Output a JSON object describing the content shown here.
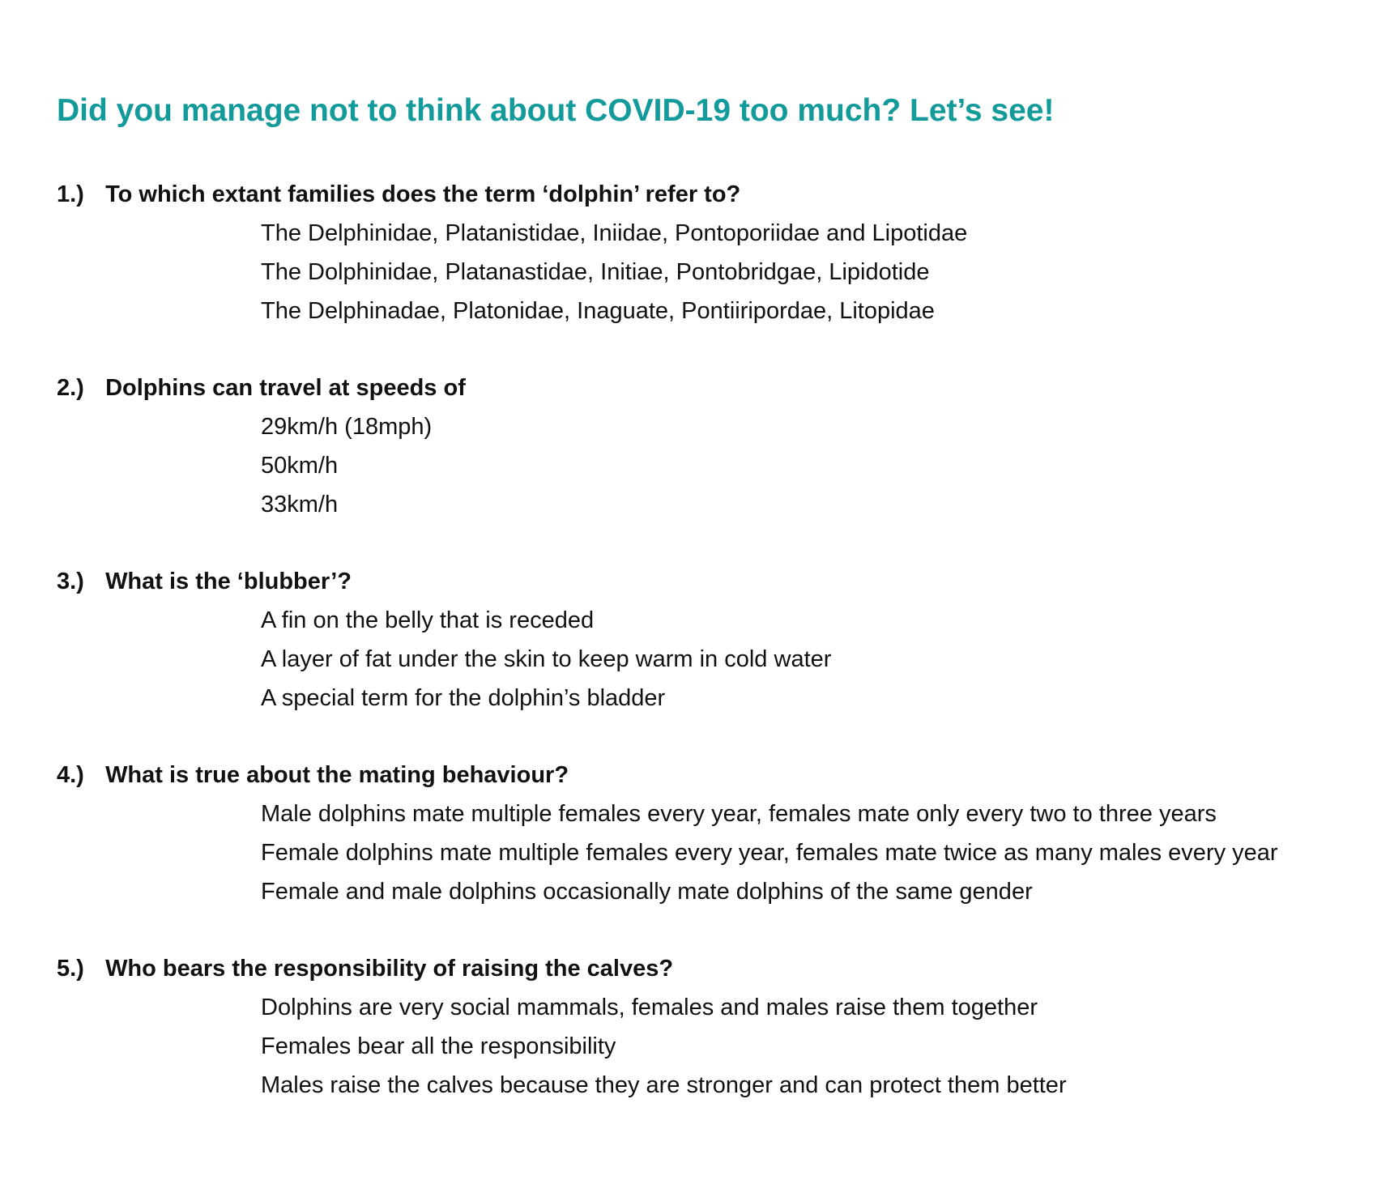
{
  "title": "Did you manage not to think about COVID-19 too much? Let’s see!",
  "questions": [
    {
      "number": "1.)",
      "text": "To which extant families does the term ‘dolphin’ refer to?",
      "options": [
        "The Delphinidae, Platanistidae, Iniidae, Pontoporiidae and Lipotidae",
        "The Dolphinidae, Platanastidae, Initiae, Pontobridgae, Lipidotide",
        "The Delphinadae, Platonidae, Inaguate, Pontiiripordae, Litopidae"
      ]
    },
    {
      "number": "2.)",
      "text": "Dolphins can travel at speeds of",
      "options": [
        "29km/h (18mph)",
        "50km/h",
        "33km/h"
      ]
    },
    {
      "number": "3.)",
      "text": "What is the ‘blubber’?",
      "options": [
        "A fin on the belly that is receded",
        "A layer of fat under the skin to keep warm in cold water",
        "A special term for the dolphin’s bladder"
      ]
    },
    {
      "number": "4.)",
      "text": "What is true about the mating behaviour?",
      "options": [
        "Male dolphins mate multiple females every year, females mate only every two to three years",
        "Female dolphins mate multiple females every year, females mate twice as many males every year",
        "Female and male dolphins occasionally mate dolphins of the same gender"
      ]
    },
    {
      "number": "5.)",
      "text": "Who bears the responsibility of raising the calves?",
      "options": [
        "Dolphins are very social mammals, females and males raise them together",
        "Females bear all the responsibility",
        "Males raise the calves because they are stronger and can protect them better"
      ]
    }
  ]
}
